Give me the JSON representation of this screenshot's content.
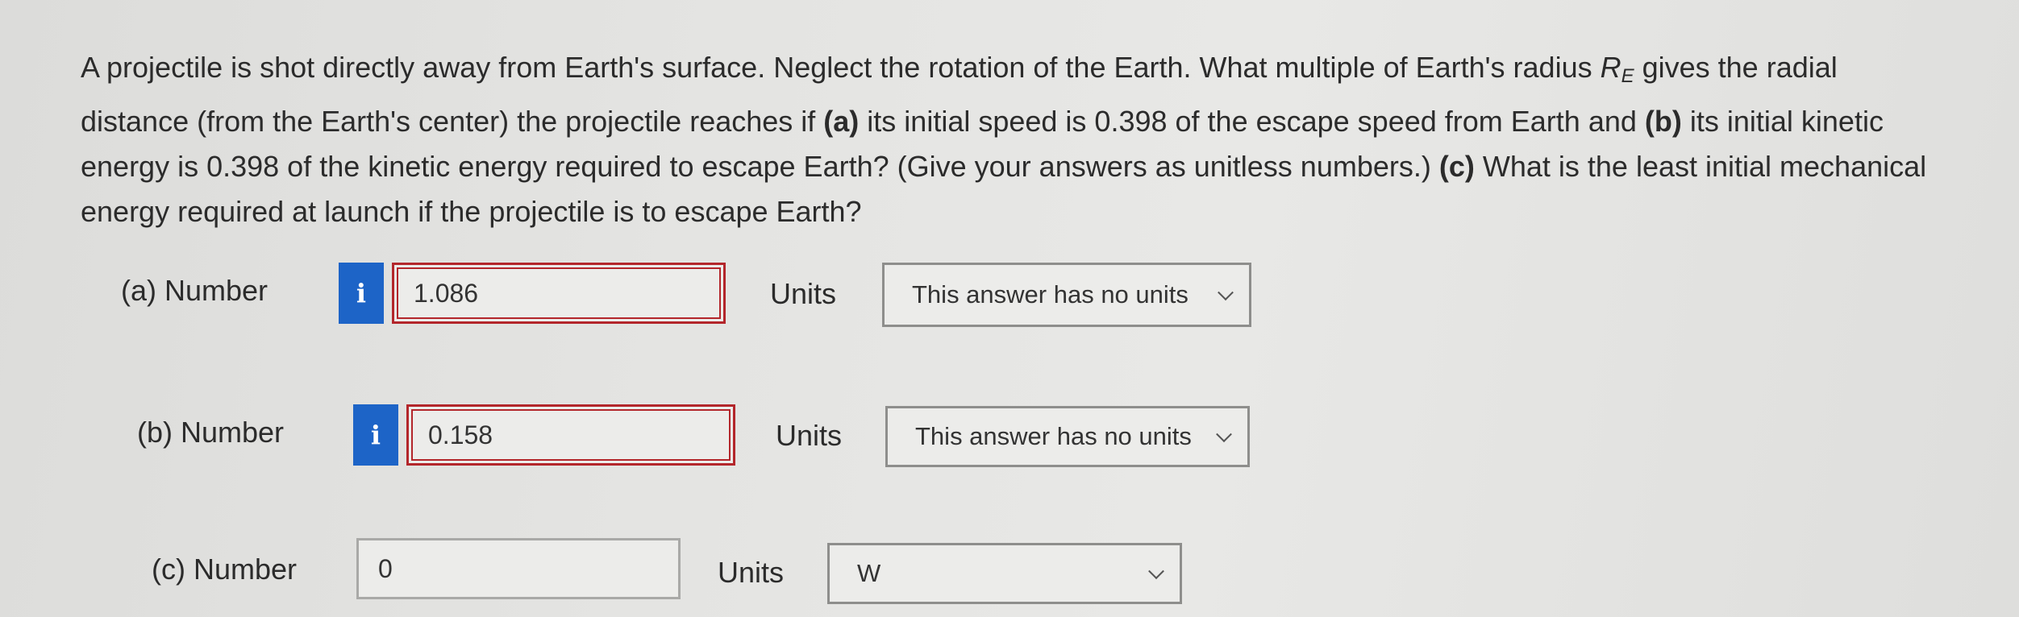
{
  "question": {
    "line1_pre": "A projectile is shot directly away from Earth's surface. Neglect the rotation of the Earth. What multiple of Earth's radius ",
    "symbol": "R",
    "symbol_sub": "E",
    "line1_post": " gives the radial distance (from the Earth's center) the projectile reaches if ",
    "part_a_marker": "(a)",
    "text_a": " its initial speed is 0.398 of the escape speed from Earth and ",
    "part_b_marker": "(b)",
    "text_b": " its initial kinetic energy is 0.398 of the kinetic energy required to escape Earth? (Give your answers as unitless numbers.) ",
    "part_c_marker": "(c)",
    "text_c": " What is the least initial mechanical energy required at launch if the projectile is to escape Earth?"
  },
  "parts": {
    "a": {
      "label": "(a)  Number",
      "info_icon": "i",
      "value": "1.086",
      "units_label": "Units",
      "units_selected": "This answer has no units"
    },
    "b": {
      "label": "(b)  Number",
      "info_icon": "i",
      "value": "0.158",
      "units_label": "Units",
      "units_selected": "This answer has no units"
    },
    "c": {
      "label": "(c)  Number",
      "value": "0",
      "units_label": "Units",
      "units_selected": "W"
    }
  },
  "colors": {
    "info_button": "#1d64c7",
    "incorrect_border": "#b3262b"
  }
}
